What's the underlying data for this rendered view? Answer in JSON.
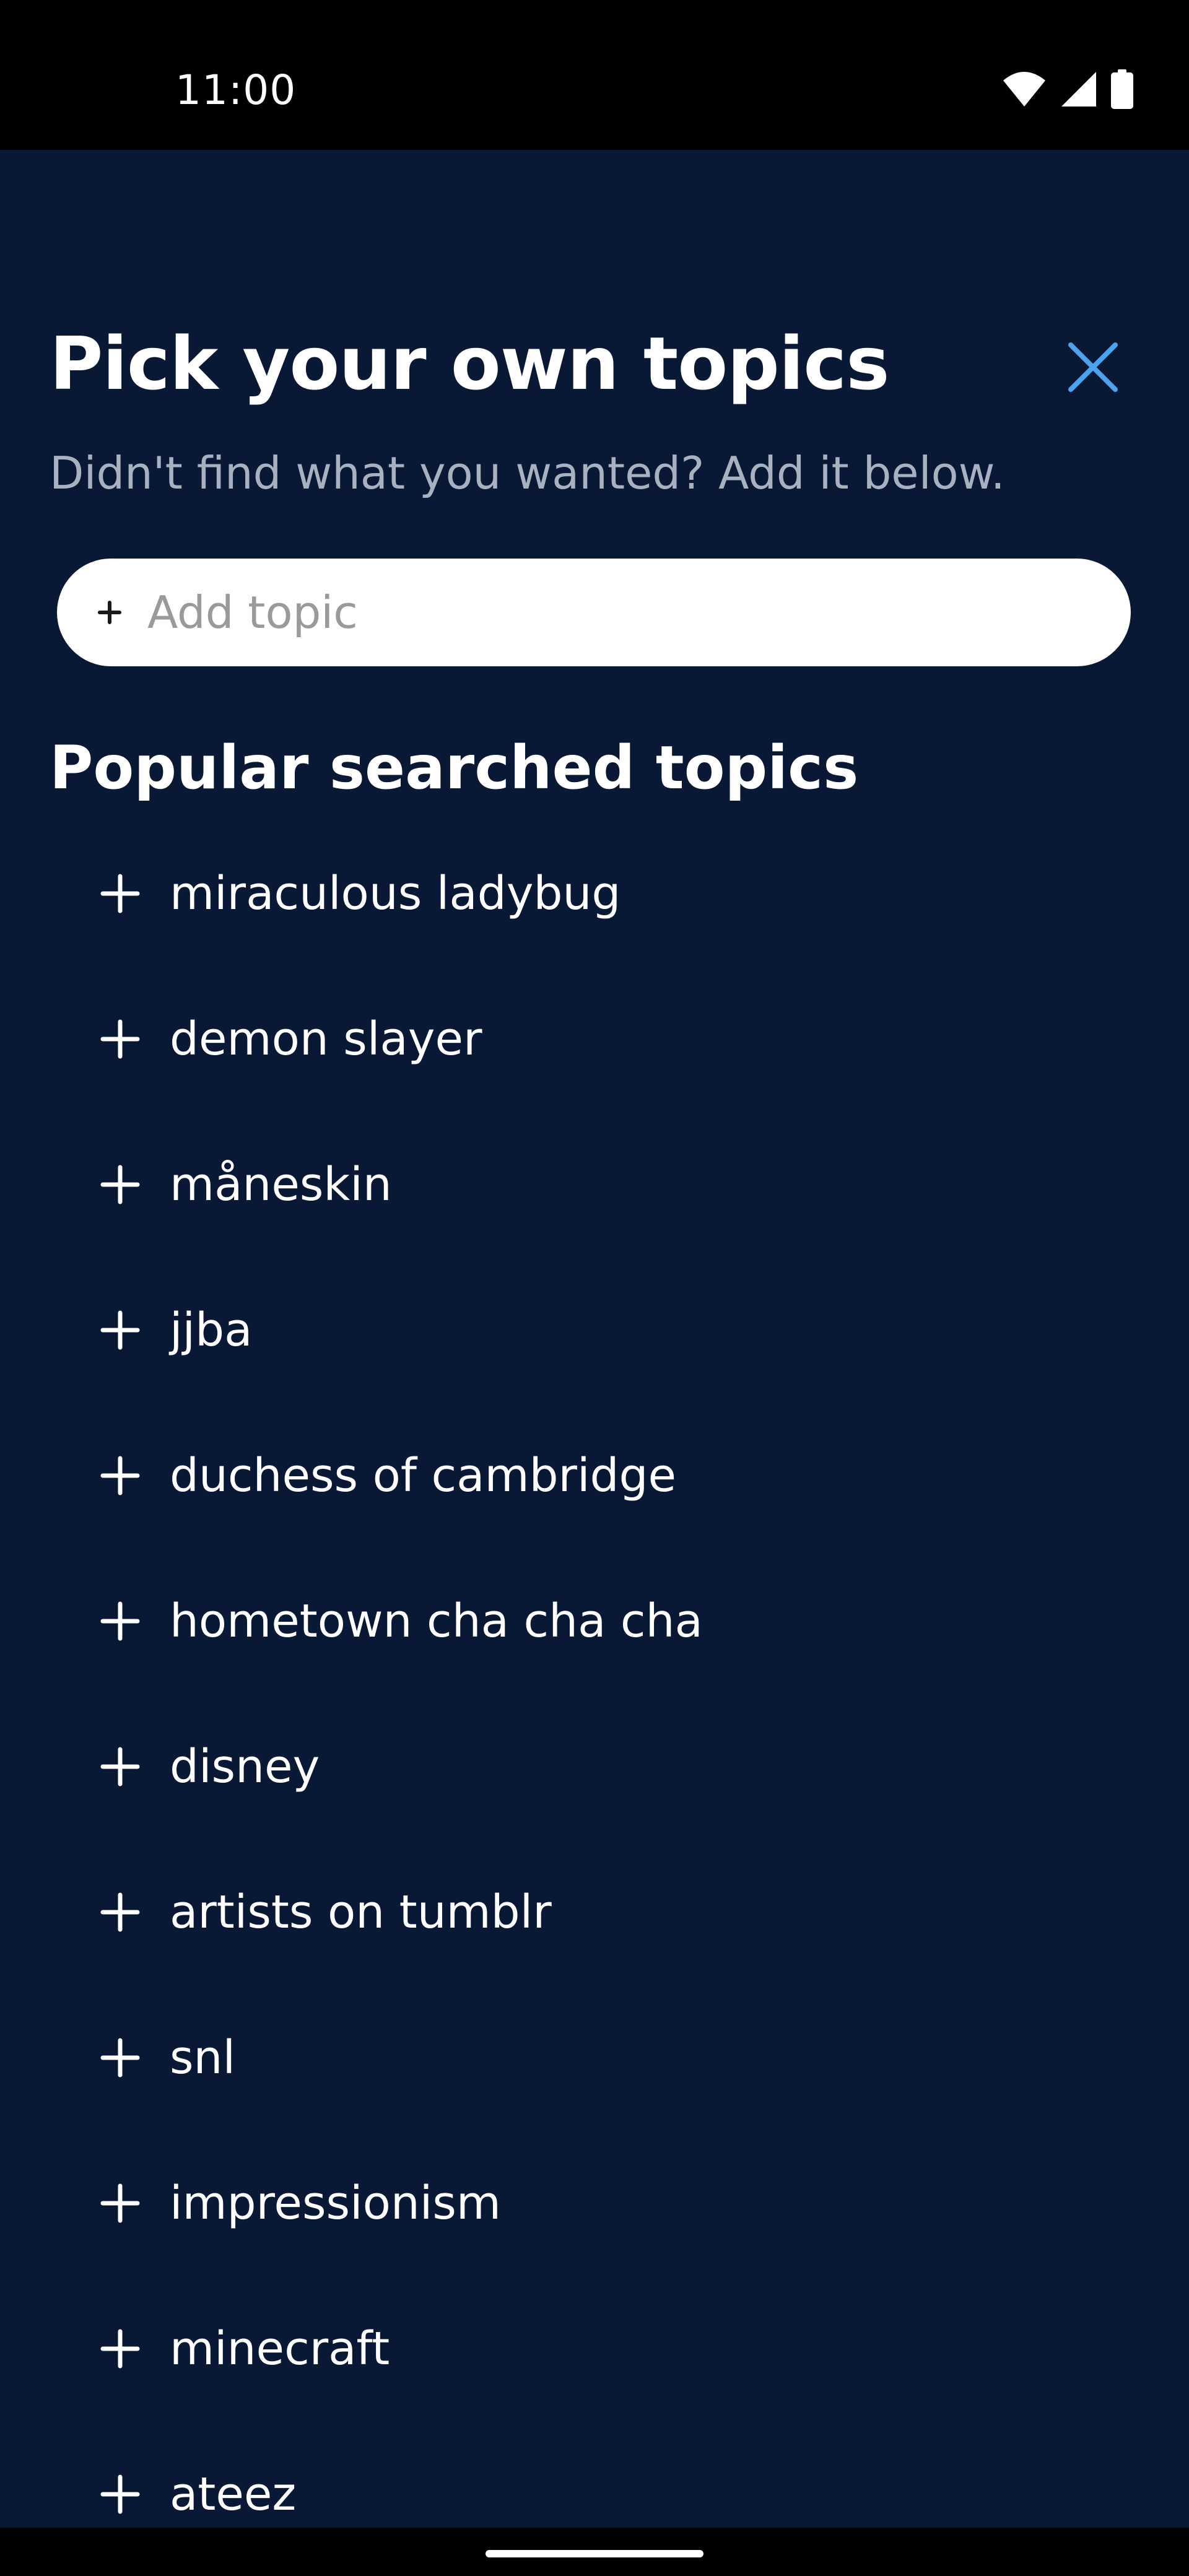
{
  "status_bar": {
    "time": "11:00",
    "icons": [
      "wifi-icon",
      "cellular-signal-icon",
      "battery-icon"
    ]
  },
  "header": {
    "title": "Pick your own topics",
    "subtitle": "Didn't find what you wanted? Add it below.",
    "close_icon": "close-icon"
  },
  "add_topic": {
    "placeholder": "Add topic",
    "icon": "plus-icon"
  },
  "popular": {
    "heading": "Popular searched topics",
    "items": [
      {
        "label": "miraculous ladybug"
      },
      {
        "label": "demon slayer"
      },
      {
        "label": "måneskin"
      },
      {
        "label": "jjba"
      },
      {
        "label": "duchess of cambridge"
      },
      {
        "label": "hometown cha cha cha"
      },
      {
        "label": "disney"
      },
      {
        "label": "artists on tumblr"
      },
      {
        "label": "snl"
      },
      {
        "label": "impressionism"
      },
      {
        "label": "minecraft"
      },
      {
        "label": "ateez"
      }
    ]
  },
  "colors": {
    "background": "#081835",
    "accent": "#4aa3ec",
    "text": "#ffffff",
    "muted_text": "#a8b1c0"
  }
}
